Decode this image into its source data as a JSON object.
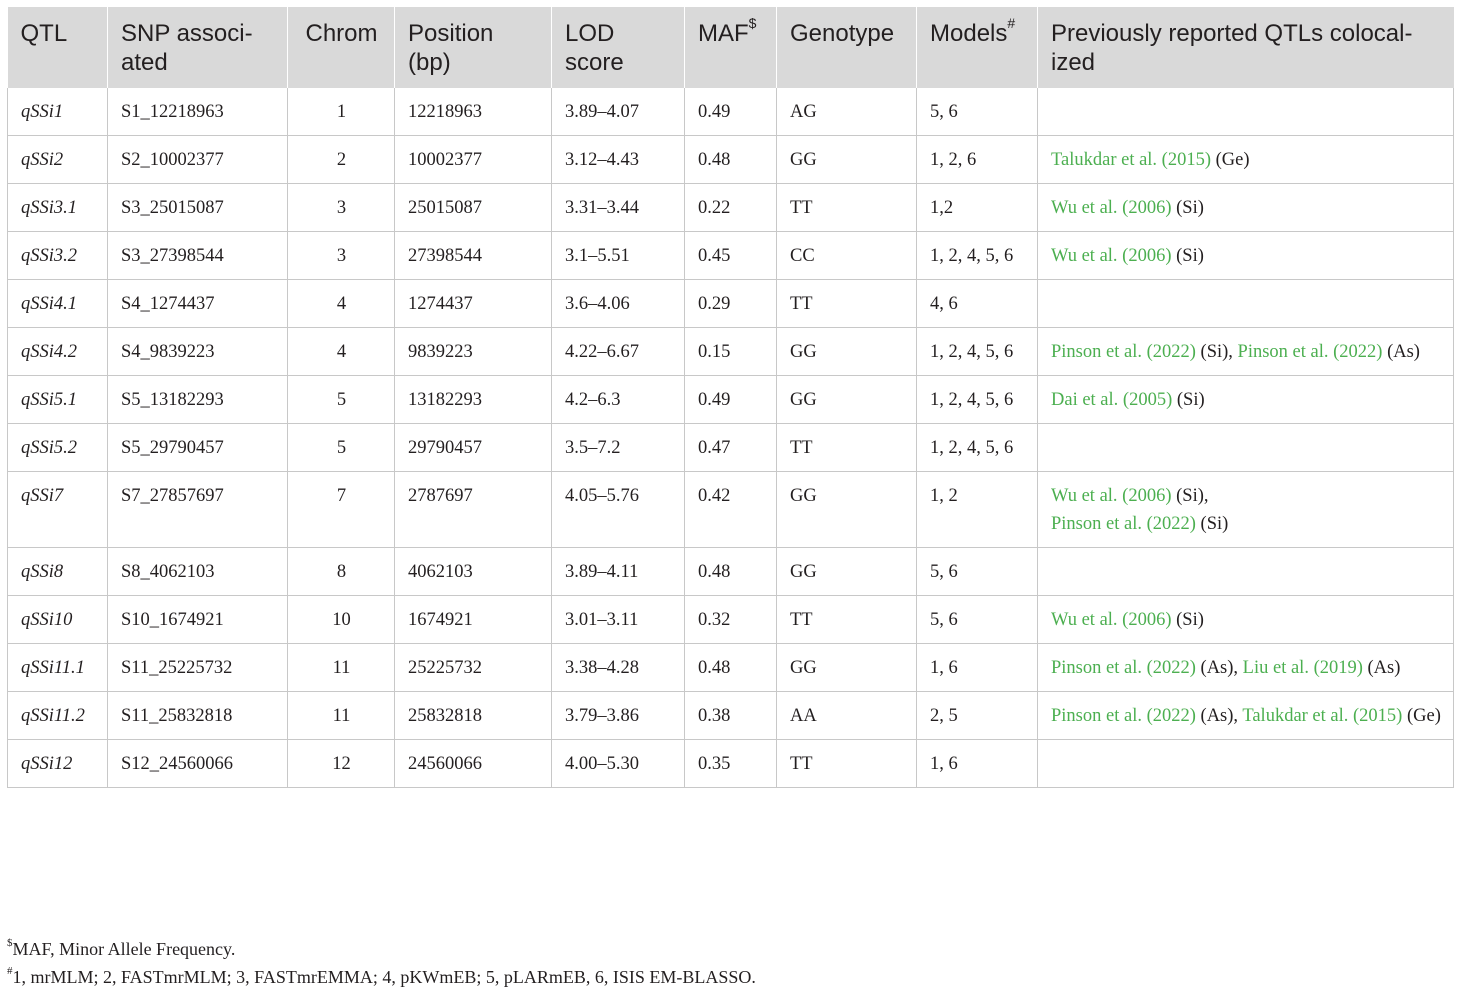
{
  "table": {
    "headers": [
      {
        "text": "QTL",
        "sup": ""
      },
      {
        "text": "SNP associ-ated",
        "sup": ""
      },
      {
        "text": "Chrom",
        "sup": ""
      },
      {
        "text": "Position (bp)",
        "sup": ""
      },
      {
        "text": "LOD score",
        "sup": ""
      },
      {
        "text": "MAF",
        "sup": "$"
      },
      {
        "text": "Genotype",
        "sup": ""
      },
      {
        "text": "Models",
        "sup": "#"
      },
      {
        "text": "Previously reported QTLs colocal-ized",
        "sup": ""
      }
    ],
    "rows": [
      {
        "qtl": "qSSi1",
        "snp": "S1_12218963",
        "chrom": "1",
        "position": "12218963",
        "lod": "3.89–4.07",
        "maf": "0.49",
        "genotype": "AG",
        "models": "5, 6",
        "refs": []
      },
      {
        "qtl": "qSSi2",
        "snp": "S2_10002377",
        "chrom": "2",
        "position": "10002377",
        "lod": "3.12–4.43",
        "maf": "0.48",
        "genotype": "GG",
        "models": "1, 2, 6",
        "refs": [
          {
            "cite": "Talukdar et al. (2015)",
            "tag": " (Ge)"
          }
        ]
      },
      {
        "qtl": "qSSi3.1",
        "snp": "S3_25015087",
        "chrom": "3",
        "position": "25015087",
        "lod": "3.31–3.44",
        "maf": "0.22",
        "genotype": "TT",
        "models": "1,2",
        "refs": [
          {
            "cite": "Wu et al. (2006)",
            "tag": " (Si)"
          }
        ]
      },
      {
        "qtl": "qSSi3.2",
        "snp": "S3_27398544",
        "chrom": "3",
        "position": "27398544",
        "lod": "3.1–5.51",
        "maf": "0.45",
        "genotype": "CC",
        "models": "1, 2, 4, 5, 6",
        "refs": [
          {
            "cite": "Wu et al. (2006)",
            "tag": " (Si)"
          }
        ]
      },
      {
        "qtl": "qSSi4.1",
        "snp": "S4_1274437",
        "chrom": "4",
        "position": "1274437",
        "lod": "3.6–4.06",
        "maf": "0.29",
        "genotype": "TT",
        "models": "4, 6",
        "refs": []
      },
      {
        "qtl": "qSSi4.2",
        "snp": "S4_9839223",
        "chrom": "4",
        "position": "9839223",
        "lod": "4.22–6.67",
        "maf": "0.15",
        "genotype": "GG",
        "models": "1, 2, 4, 5, 6",
        "refs": [
          {
            "cite": "Pinson et al. (2022)",
            "tag": " (Si), "
          },
          {
            "cite": "Pinson et al. (2022)",
            "tag": " (As)"
          }
        ]
      },
      {
        "qtl": "qSSi5.1",
        "snp": "S5_13182293",
        "chrom": "5",
        "position": "13182293",
        "lod": "4.2–6.3",
        "maf": "0.49",
        "genotype": "GG",
        "models": "1, 2, 4, 5, 6",
        "refs": [
          {
            "cite": "Dai et al. (2005)",
            "tag": " (Si)"
          }
        ]
      },
      {
        "qtl": "qSSi5.2",
        "snp": "S5_29790457",
        "chrom": "5",
        "position": "29790457",
        "lod": "3.5–7.2",
        "maf": "0.47",
        "genotype": "TT",
        "models": "1, 2, 4, 5, 6",
        "refs": []
      },
      {
        "qtl": "qSSi7",
        "snp": "S7_27857697",
        "chrom": "7",
        "position": "2787697",
        "lod": "4.05–5.76",
        "maf": "0.42",
        "genotype": "GG",
        "models": "1, 2",
        "refs": [
          {
            "cite": "Wu et al. (2006)",
            "tag": " (Si),",
            "br": true
          },
          {
            "cite": "Pinson et al. (2022)",
            "tag": " (Si)"
          }
        ]
      },
      {
        "qtl": "qSSi8",
        "snp": "S8_4062103",
        "chrom": "8",
        "position": "4062103",
        "lod": "3.89–4.11",
        "maf": "0.48",
        "genotype": "GG",
        "models": "5, 6",
        "refs": []
      },
      {
        "qtl": "qSSi10",
        "snp": "S10_1674921",
        "chrom": "10",
        "position": "1674921",
        "lod": "3.01–3.11",
        "maf": "0.32",
        "genotype": "TT",
        "models": "5, 6",
        "refs": [
          {
            "cite": "Wu et al. (2006)",
            "tag": " (Si)"
          }
        ]
      },
      {
        "qtl": "qSSi11.1",
        "snp": "S11_25225732",
        "chrom": "11",
        "position": "25225732",
        "lod": "3.38–4.28",
        "maf": "0.48",
        "genotype": "GG",
        "models": "1, 6",
        "refs": [
          {
            "cite": "Pinson et al. (2022)",
            "tag": " (As), "
          },
          {
            "cite": "Liu et al. (2019)",
            "tag": " (As)"
          }
        ]
      },
      {
        "qtl": "qSSi11.2",
        "snp": "S11_25832818",
        "chrom": "11",
        "position": "25832818",
        "lod": "3.79–3.86",
        "maf": "0.38",
        "genotype": "AA",
        "models": "2, 5",
        "refs": [
          {
            "cite": "Pinson et al. (2022)",
            "tag": " (As), "
          },
          {
            "cite": "Talukdar et al. (2015)",
            "tag": " (Ge)"
          }
        ]
      },
      {
        "qtl": "qSSi12",
        "snp": "S12_24560066",
        "chrom": "12",
        "position": "24560066",
        "lod": "4.00–5.30",
        "maf": "0.35",
        "genotype": "TT",
        "models": "1, 6",
        "refs": []
      }
    ]
  },
  "footnotes": [
    {
      "mark": "$",
      "text": "MAF, Minor Allele Frequency."
    },
    {
      "mark": "#",
      "text": "1, mrMLM; 2, FASTmrMLM; 3, FASTmrEMMA; 4, pKWmEB; 5, pLARmEB, 6, ISIS EM-BLASSO."
    }
  ],
  "colors": {
    "header_bg": "#d9d9d9",
    "link": "#4caf50",
    "border": "#c8c8c8",
    "text": "#231f20"
  }
}
